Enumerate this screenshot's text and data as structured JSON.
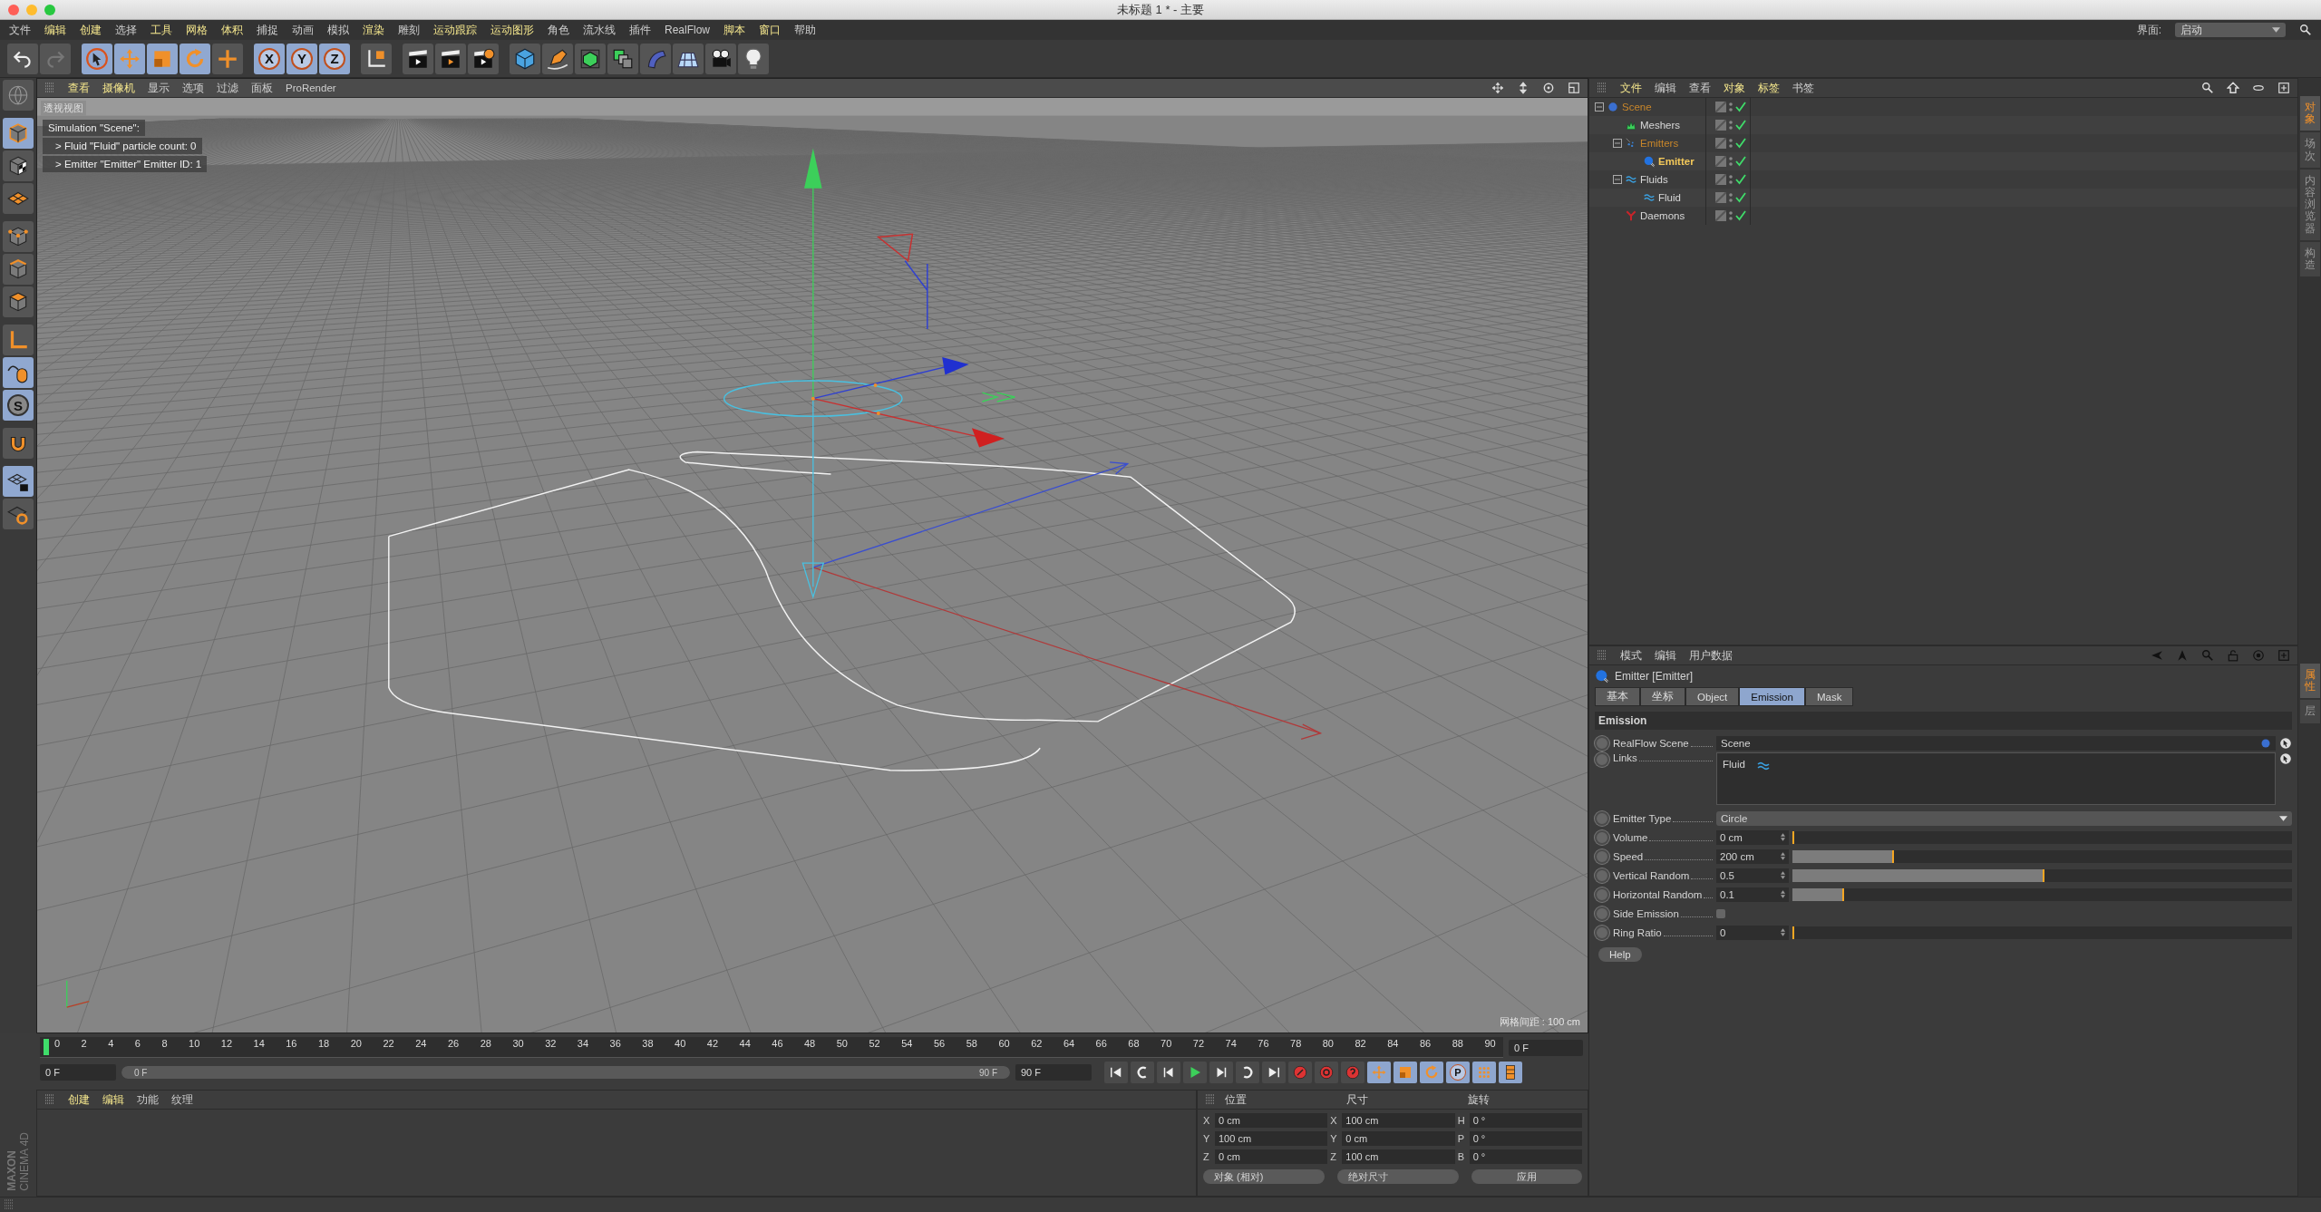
{
  "window": {
    "title": "未标题 1 * - 主要"
  },
  "menu": [
    {
      "label": "文件",
      "highlighted": false
    },
    {
      "label": "编辑",
      "highlighted": true
    },
    {
      "label": "创建",
      "highlighted": true
    },
    {
      "label": "选择",
      "highlighted": false
    },
    {
      "label": "工具",
      "highlighted": true
    },
    {
      "label": "网格",
      "highlighted": true
    },
    {
      "label": "体积",
      "highlighted": true
    },
    {
      "label": "捕捉",
      "highlighted": false
    },
    {
      "label": "动画",
      "highlighted": false
    },
    {
      "label": "模拟",
      "highlighted": false
    },
    {
      "label": "渲染",
      "highlighted": true
    },
    {
      "label": "雕刻",
      "highlighted": false
    },
    {
      "label": "运动跟踪",
      "highlighted": true
    },
    {
      "label": "运动图形",
      "highlighted": true
    },
    {
      "label": "角色",
      "highlighted": false
    },
    {
      "label": "流水线",
      "highlighted": false
    },
    {
      "label": "插件",
      "highlighted": false
    },
    {
      "label": "RealFlow",
      "highlighted": false
    },
    {
      "label": "脚本",
      "highlighted": true
    },
    {
      "label": "窗口",
      "highlighted": true
    },
    {
      "label": "帮助",
      "highlighted": false
    }
  ],
  "layout_picker": {
    "label": "界面:",
    "value": "启动"
  },
  "toolbar": [
    {
      "kind": "undo",
      "selected": false
    },
    {
      "kind": "redo",
      "selected": false
    },
    {
      "kind": "select",
      "selected": true
    },
    {
      "kind": "move",
      "selected": true
    },
    {
      "kind": "scale",
      "selected": true
    },
    {
      "kind": "rotate",
      "selected": true
    },
    {
      "kind": "add",
      "selected": false
    },
    {
      "kind": "axis",
      "label": "X",
      "selected": true
    },
    {
      "kind": "axis",
      "label": "Y",
      "selected": true
    },
    {
      "kind": "axis",
      "label": "Z",
      "selected": true
    },
    {
      "kind": "coords",
      "selected": false
    },
    {
      "kind": "render-view",
      "selected": false
    },
    {
      "kind": "render",
      "selected": false
    },
    {
      "kind": "render-settings",
      "selected": false
    },
    {
      "kind": "cube",
      "selected": false
    },
    {
      "kind": "pen",
      "selected": false
    },
    {
      "kind": "subdivision",
      "selected": false
    },
    {
      "kind": "array",
      "selected": false
    },
    {
      "kind": "deformer",
      "selected": false
    },
    {
      "kind": "floor",
      "selected": false
    },
    {
      "kind": "camera",
      "selected": false
    },
    {
      "kind": "light",
      "selected": false
    }
  ],
  "left_tools": [
    {
      "kind": "globe",
      "selected": false
    },
    {
      "kind": "model",
      "selected": true
    },
    {
      "kind": "texture",
      "selected": false
    },
    {
      "kind": "workplane",
      "selected": false
    },
    {
      "kind": "points",
      "selected": false
    },
    {
      "kind": "edges",
      "selected": false
    },
    {
      "kind": "polygons",
      "selected": false
    },
    {
      "kind": "axis-mode",
      "selected": false
    },
    {
      "kind": "tweak",
      "selected": true
    },
    {
      "kind": "snap",
      "label": "S",
      "selected": true
    },
    {
      "kind": "magnet",
      "selected": false
    },
    {
      "kind": "lock-workplane",
      "selected": true
    },
    {
      "kind": "workplane-sync",
      "selected": false
    }
  ],
  "viewport": {
    "menu": [
      {
        "label": "查看",
        "highlighted": true
      },
      {
        "label": "摄像机",
        "highlighted": true
      },
      {
        "label": "显示",
        "highlighted": false
      },
      {
        "label": "选项",
        "highlighted": false
      },
      {
        "label": "过滤",
        "highlighted": false
      },
      {
        "label": "面板",
        "highlighted": false
      },
      {
        "label": "ProRender",
        "highlighted": false
      }
    ],
    "view_label": "透视视图",
    "hud_lines": [
      "Simulation \"Scene\":",
      "> Fluid \"Fluid\" particle count: 0",
      "> Emitter \"Emitter\" Emitter ID: 1"
    ],
    "grid_spacing": "网格间距 : 100 cm"
  },
  "timeline": {
    "ruler_labels": [
      "0",
      "2",
      "4",
      "6",
      "8",
      "10",
      "12",
      "14",
      "16",
      "18",
      "20",
      "22",
      "24",
      "26",
      "28",
      "30",
      "32",
      "34",
      "36",
      "38",
      "40",
      "42",
      "44",
      "46",
      "48",
      "50",
      "52",
      "54",
      "56",
      "58",
      "60",
      "62",
      "64",
      "66",
      "68",
      "70",
      "72",
      "74",
      "76",
      "78",
      "80",
      "82",
      "84",
      "86",
      "88",
      "90"
    ],
    "playhead": {
      "level": 0
    },
    "current_frame": "0 F",
    "start_field": "0 F",
    "range_bar": {
      "level": 1
    },
    "range_start": "0 F",
    "range_end": "90 F",
    "end_field": "90 F",
    "transport": [
      {
        "kind": "first"
      },
      {
        "kind": "prev-key"
      },
      {
        "kind": "prev-frame"
      },
      {
        "kind": "play"
      },
      {
        "kind": "next-frame"
      },
      {
        "kind": "next-key"
      },
      {
        "kind": "last"
      },
      {
        "kind": "record"
      },
      {
        "kind": "autokey"
      },
      {
        "kind": "keyset"
      },
      {
        "kind": "move"
      },
      {
        "kind": "scale"
      },
      {
        "kind": "rotate"
      },
      {
        "kind": "param",
        "label": "P"
      },
      {
        "kind": "pla"
      },
      {
        "kind": "timeline-window"
      }
    ]
  },
  "materials": {
    "menu": [
      {
        "label": "创建",
        "highlighted": true
      },
      {
        "label": "编辑",
        "highlighted": true
      },
      {
        "label": "功能",
        "highlighted": false
      },
      {
        "label": "纹理",
        "highlighted": false
      }
    ]
  },
  "coordinates": {
    "headers": [
      "位置",
      "尺寸",
      "旋转"
    ],
    "rows": [
      {
        "axis_1": "X",
        "position": "0 cm",
        "axis_2": "X",
        "size": "100 cm",
        "axis_3": "H",
        "rotation": "0 °"
      },
      {
        "axis_1": "Y",
        "position": "100 cm",
        "axis_2": "Y",
        "size": "0 cm",
        "axis_3": "P",
        "rotation": "0 °"
      },
      {
        "axis_1": "Z",
        "position": "0 cm",
        "axis_2": "Z",
        "size": "100 cm",
        "axis_3": "B",
        "rotation": "0 °"
      }
    ],
    "mode_dropdown": "对象 (相对)",
    "size_dropdown": "绝对尺寸",
    "apply_button": "应用"
  },
  "object_manager": {
    "menu": [
      {
        "label": "文件",
        "highlighted": true
      },
      {
        "label": "编辑",
        "highlighted": false
      },
      {
        "label": "查看",
        "highlighted": false
      },
      {
        "label": "对象",
        "highlighted": true
      },
      {
        "label": "标签",
        "highlighted": true
      },
      {
        "label": "书签",
        "highlighted": false
      }
    ],
    "tree": [
      {
        "name": "Scene",
        "kind": "scene",
        "color": "#c8862a",
        "selected": false,
        "expanded": true,
        "enabled": true,
        "children": [
          {
            "name": "Meshers",
            "kind": "meshers",
            "color": "#d8d8d8",
            "selected": false,
            "enabled": true
          },
          {
            "name": "Emitters",
            "kind": "emitters",
            "color": "#c8862a",
            "selected": false,
            "expanded": true,
            "enabled": true,
            "children": [
              {
                "name": "Emitter",
                "kind": "emitter",
                "color": "#f4c95a",
                "selected": true,
                "enabled": true
              }
            ]
          },
          {
            "name": "Fluids",
            "kind": "fluids",
            "color": "#d8d8d8",
            "selected": false,
            "expanded": true,
            "enabled": true,
            "children": [
              {
                "name": "Fluid",
                "kind": "fluid",
                "color": "#d8d8d8",
                "selected": false,
                "enabled": true
              }
            ]
          },
          {
            "name": "Daemons",
            "kind": "daemons",
            "color": "#d8d8d8",
            "selected": false,
            "enabled": true
          }
        ]
      }
    ]
  },
  "side_tabs_top": [
    {
      "label": "对象",
      "selected": true
    },
    {
      "label": "场次",
      "selected": false
    },
    {
      "label": "内容浏览器",
      "selected": false
    },
    {
      "label": "构造",
      "selected": false
    }
  ],
  "attributes": {
    "menu": [
      {
        "label": "模式",
        "highlighted": false
      },
      {
        "label": "编辑",
        "highlighted": false
      },
      {
        "label": "用户数据",
        "highlighted": false
      }
    ],
    "title": "Emitter [Emitter]",
    "tabs": [
      {
        "label": "基本",
        "selected": false
      },
      {
        "label": "坐标",
        "selected": false
      },
      {
        "label": "Object",
        "selected": false
      },
      {
        "label": "Emission",
        "selected": true
      },
      {
        "label": "Mask",
        "selected": false
      }
    ],
    "section": "Emission",
    "rows": [
      {
        "kind": "link",
        "label": "RealFlow Scene",
        "value": "Scene"
      },
      {
        "kind": "list",
        "label": "Links",
        "value": "Fluid"
      },
      {
        "kind": "dropdown",
        "label": "Emitter Type",
        "value": "Circle"
      },
      {
        "kind": "slider",
        "label": "Volume",
        "value": "0 cm",
        "level": 0
      },
      {
        "kind": "slider",
        "label": "Speed",
        "value": "200 cm",
        "level": 0.2
      },
      {
        "kind": "slider",
        "label": "Vertical Random",
        "value": "0.5",
        "level": 0.5
      },
      {
        "kind": "slider",
        "label": "Horizontal Random",
        "value": "0.1",
        "level": 0.1
      },
      {
        "kind": "checkbox",
        "label": "Side Emission",
        "checked": false
      },
      {
        "kind": "slider",
        "label": "Ring Ratio",
        "value": "0",
        "level": 0
      }
    ],
    "help_button": "Help"
  },
  "side_tabs_bottom": [
    {
      "label": "属性",
      "selected": true
    },
    {
      "label": "层",
      "selected": false
    }
  ],
  "logo": {
    "brand": "MAXON",
    "product": "CINEMA 4D"
  }
}
